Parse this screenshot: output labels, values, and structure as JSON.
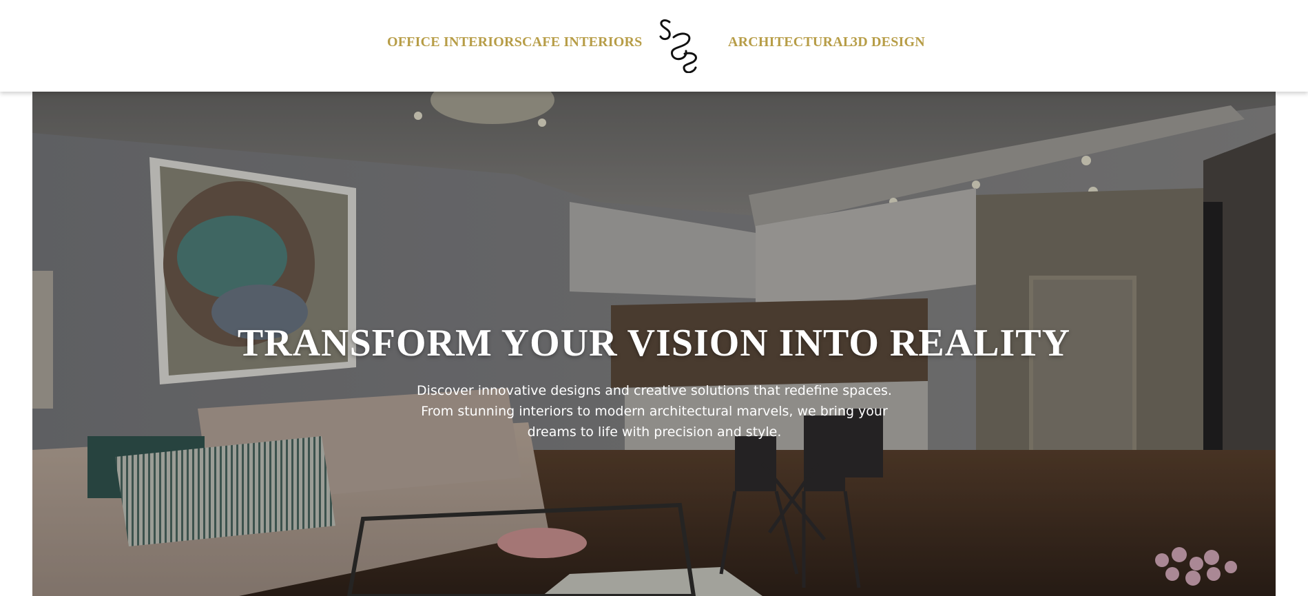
{
  "nav": {
    "left": [
      "OFFICE INTERIORS",
      "CAFE INTERIORS"
    ],
    "right": [
      "ARCHITECTURAL",
      "3D DESIGN"
    ],
    "link_color": "#b79d47"
  },
  "logo": {
    "text": "S8S"
  },
  "hero": {
    "title": "TRANSFORM YOUR VISION INTO REALITY",
    "subtitle": "Discover innovative designs and creative solutions that redefine spaces. From stunning interiors to modern architectural marvels, we bring your dreams to life with precision and style.",
    "image": "modern-apartment-living-room-kitchen-photo"
  }
}
